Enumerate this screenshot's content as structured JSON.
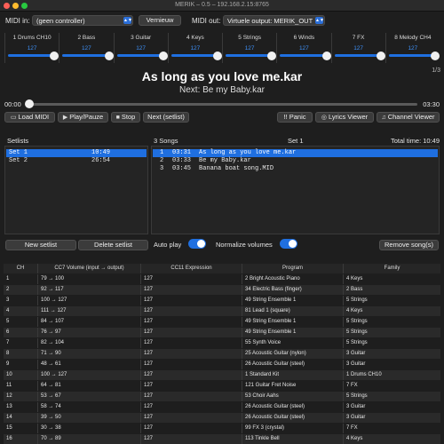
{
  "window": {
    "title": "MERIK – 0.5 – 192.168.2.15:8765"
  },
  "midi_in": {
    "label": "MIDI in:",
    "value": "(geen controller)"
  },
  "refresh_button": "Vernieuw",
  "midi_out": {
    "label": "MIDI out:",
    "value": "Virtuele output: MERIK_OUT"
  },
  "channels": [
    {
      "name": "1 Drums CH10",
      "value": "127",
      "level": 1.0
    },
    {
      "name": "2 Bass",
      "value": "127",
      "level": 1.0
    },
    {
      "name": "3 Guitar",
      "value": "127",
      "level": 1.0
    },
    {
      "name": "4 Keys",
      "value": "127",
      "level": 1.0
    },
    {
      "name": "5 Strings",
      "value": "127",
      "level": 1.0
    },
    {
      "name": "6 Winds",
      "value": "127",
      "level": 1.0
    },
    {
      "name": "7 FX",
      "value": "127",
      "level": 1.0
    },
    {
      "name": "8 Melody CH4",
      "value": "127",
      "level": 1.0
    }
  ],
  "now_playing": {
    "title": "As long as you love me.kar",
    "next": "Next: Be my Baby.kar",
    "page": "1/3"
  },
  "progress": {
    "elapsed": "00:00",
    "total": "03:30",
    "fraction": 0.0
  },
  "controls": {
    "load": "Load MIDI",
    "play": "Play/Pauze",
    "stop": "Stop",
    "next": "Next (setlist)",
    "panic": "!! Panic",
    "lyrics": "Lyrics Viewer",
    "channel_viewer": "Channel Viewer"
  },
  "setlists": {
    "header": "Setlists",
    "items": [
      {
        "name": "Set 1",
        "time": "10:49",
        "selected": true
      },
      {
        "name": "Set 2",
        "time": "26:54",
        "selected": false
      }
    ],
    "new_button": "New setlist",
    "delete_button": "Delete setlist"
  },
  "songs": {
    "count_label": "3 Songs",
    "set_label": "Set 1",
    "total_label": "Total time: 10:49",
    "items": [
      {
        "n": "1",
        "time": "03:31",
        "name": "As long as you love me.kar",
        "selected": true
      },
      {
        "n": "2",
        "time": "03:33",
        "name": "Be my Baby.kar",
        "selected": false
      },
      {
        "n": "3",
        "time": "03:45",
        "name": "Banana boat song.MID",
        "selected": false
      }
    ],
    "remove_button": "Remove song(s)"
  },
  "options": {
    "autoplay": "Auto play",
    "normalize": "Normalize volumes",
    "autoplay_on": true,
    "normalize_on": true
  },
  "table": {
    "headers": [
      "CH",
      "CC7 Volume (input → output)",
      "CC11 Expression",
      "Program",
      "Family"
    ],
    "rows": [
      [
        "1",
        "79 → 100",
        "127",
        "2 Bright Acoustic Piano",
        "4 Keys"
      ],
      [
        "2",
        "92 → 117",
        "127",
        "34 Electric Bass (finger)",
        "2 Bass"
      ],
      [
        "3",
        "100 → 127",
        "127",
        "49 String Ensemble 1",
        "5 Strings"
      ],
      [
        "4",
        "111 → 127",
        "127",
        "81 Lead 1 (square)",
        "4 Keys"
      ],
      [
        "5",
        "84 → 107",
        "127",
        "49 String Ensemble 1",
        "5 Strings"
      ],
      [
        "6",
        "76 → 97",
        "127",
        "49 String Ensemble 1",
        "5 Strings"
      ],
      [
        "7",
        "82 → 104",
        "127",
        "55 Synth Voice",
        "5 Strings"
      ],
      [
        "8",
        "71 → 90",
        "127",
        "25 Acoustic Guitar (nylon)",
        "3 Guitar"
      ],
      [
        "9",
        "48 → 61",
        "127",
        "26 Acoustic Guitar (steel)",
        "3 Guitar"
      ],
      [
        "10",
        "100 → 127",
        "127",
        "1 Standard Kit",
        "1 Drums CH10"
      ],
      [
        "11",
        "64 → 81",
        "127",
        "121 Guitar Fret Noise",
        "7 FX"
      ],
      [
        "12",
        "53 → 67",
        "127",
        "53 Choir Aahs",
        "5 Strings"
      ],
      [
        "13",
        "58 → 74",
        "127",
        "26 Acoustic Guitar (steel)",
        "3 Guitar"
      ],
      [
        "14",
        "39 → 50",
        "127",
        "26 Acoustic Guitar (steel)",
        "3 Guitar"
      ],
      [
        "15",
        "30 → 38",
        "127",
        "99 FX 3 (crystal)",
        "7 FX"
      ],
      [
        "16",
        "70 → 89",
        "127",
        "113 Tinkle Bell",
        "4 Keys"
      ]
    ]
  }
}
